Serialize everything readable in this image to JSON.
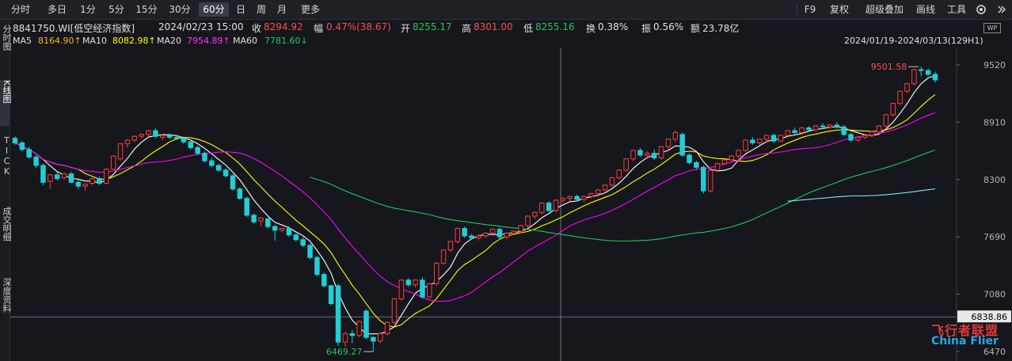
{
  "toolbar": {
    "periods": [
      "分时",
      "多日",
      "1分",
      "5分",
      "15分",
      "30分",
      "60分",
      "日",
      "周",
      "月",
      "更多"
    ],
    "active_period": "60分",
    "right": [
      "F9",
      "复权",
      "超级叠加",
      "画线",
      "工具"
    ]
  },
  "left_tabs": [
    {
      "label": "分时图",
      "active": false
    },
    {
      "label": "K线图",
      "active": true
    },
    {
      "label": "TICK",
      "active": false
    },
    {
      "label": "成交明细",
      "active": false
    },
    {
      "label": "深度资料",
      "active": false
    }
  ],
  "info_bar": {
    "code_name": "8841750.WI[低空经济指数]",
    "datetime": "2024/02/23 15:00",
    "close_label": "收",
    "close": "8294.92",
    "change_label": "幅",
    "change": "0.47%(38.67)",
    "open_label": "开",
    "open": "8255.17",
    "high_label": "高",
    "high": "8301.00",
    "low_label": "低",
    "low": "8255.16",
    "turnover_label": "换",
    "turnover": "0.38%",
    "amplitude_label": "振",
    "amplitude": "0.56%",
    "amount_label": "额",
    "amount": "23.78亿"
  },
  "ma_bar": {
    "ma5_label": "MA5",
    "ma5": "8164.90↑",
    "ma10_label": "MA10",
    "ma10": "8082.98↑",
    "ma20_label": "MA20",
    "ma20": "7954.89↑",
    "ma60_label": "MA60",
    "ma60": "7781.60↓",
    "range": "2024/01/19-2024/03/13(129H1)"
  },
  "colors": {
    "up": "#ff3b3b",
    "down": "#22cdd6",
    "ma5": "#ffffff",
    "ma10": "#ffff00",
    "ma20": "#ff00ff",
    "ma60": "#22c55e",
    "ma_cyan": "#7fe3ff"
  },
  "watermark": {
    "title": "飞行者联盟",
    "sub": "China Flier"
  },
  "chart_data": {
    "type": "candlestick",
    "title": "8841750.WI[低空经济指数]",
    "period": "60分",
    "ylim": [
      6470,
      9700
    ],
    "y_ticks": [
      "9520",
      "8910",
      "8300",
      "7690",
      "7080",
      "6470"
    ],
    "crosshair_price": "6838.86",
    "max_label": "9501.58",
    "min_label": "6469.27",
    "candles": [
      {
        "o": 8740,
        "h": 8760,
        "c": 8690,
        "l": 8670
      },
      {
        "o": 8690,
        "h": 8710,
        "c": 8620,
        "l": 8600
      },
      {
        "o": 8620,
        "h": 8650,
        "c": 8540,
        "l": 8520
      },
      {
        "o": 8540,
        "h": 8560,
        "c": 8450,
        "l": 8420
      },
      {
        "o": 8450,
        "h": 8470,
        "c": 8270,
        "l": 8240
      },
      {
        "o": 8280,
        "h": 8360,
        "c": 8350,
        "l": 8200
      },
      {
        "o": 8350,
        "h": 8380,
        "c": 8310,
        "l": 8290
      },
      {
        "o": 8320,
        "h": 8370,
        "c": 8360,
        "l": 8300
      },
      {
        "o": 8360,
        "h": 8380,
        "c": 8270,
        "l": 8260
      },
      {
        "o": 8270,
        "h": 8300,
        "c": 8230,
        "l": 8200
      },
      {
        "o": 8230,
        "h": 8260,
        "c": 8250,
        "l": 8180
      },
      {
        "o": 8260,
        "h": 8320,
        "c": 8310,
        "l": 8240
      },
      {
        "o": 8310,
        "h": 8330,
        "c": 8260,
        "l": 8240
      },
      {
        "o": 8260,
        "h": 8420,
        "c": 8410,
        "l": 8250
      },
      {
        "o": 8410,
        "h": 8560,
        "c": 8550,
        "l": 8400
      },
      {
        "o": 8520,
        "h": 8690,
        "c": 8680,
        "l": 8500
      },
      {
        "o": 8680,
        "h": 8730,
        "c": 8720,
        "l": 8640
      },
      {
        "o": 8720,
        "h": 8770,
        "c": 8760,
        "l": 8700
      },
      {
        "o": 8760,
        "h": 8790,
        "c": 8780,
        "l": 8740
      },
      {
        "o": 8780,
        "h": 8830,
        "c": 8820,
        "l": 8760
      },
      {
        "o": 8820,
        "h": 8850,
        "c": 8760,
        "l": 8740
      },
      {
        "o": 8750,
        "h": 8780,
        "c": 8770,
        "l": 8720
      },
      {
        "o": 8770,
        "h": 8790,
        "c": 8750,
        "l": 8730
      },
      {
        "o": 8750,
        "h": 8770,
        "c": 8740,
        "l": 8720
      },
      {
        "o": 8740,
        "h": 8760,
        "c": 8700,
        "l": 8680
      },
      {
        "o": 8700,
        "h": 8730,
        "c": 8640,
        "l": 8620
      },
      {
        "o": 8640,
        "h": 8660,
        "c": 8580,
        "l": 8560
      },
      {
        "o": 8580,
        "h": 8600,
        "c": 8500,
        "l": 8480
      },
      {
        "o": 8500,
        "h": 8530,
        "c": 8450,
        "l": 8430
      },
      {
        "o": 8450,
        "h": 8470,
        "c": 8400,
        "l": 8380
      },
      {
        "o": 8400,
        "h": 8420,
        "c": 8340,
        "l": 8320
      },
      {
        "o": 8340,
        "h": 8360,
        "c": 8200,
        "l": 8180
      },
      {
        "o": 8200,
        "h": 8220,
        "c": 8100,
        "l": 8080
      },
      {
        "o": 8100,
        "h": 8120,
        "c": 7920,
        "l": 7900
      },
      {
        "o": 7920,
        "h": 7940,
        "c": 7850,
        "l": 7830
      },
      {
        "o": 7860,
        "h": 7900,
        "c": 7890,
        "l": 7800
      },
      {
        "o": 7880,
        "h": 7900,
        "c": 7800,
        "l": 7780
      },
      {
        "o": 7800,
        "h": 7820,
        "c": 7760,
        "l": 7650
      },
      {
        "o": 7760,
        "h": 7790,
        "c": 7780,
        "l": 7740
      },
      {
        "o": 7780,
        "h": 7800,
        "c": 7710,
        "l": 7690
      },
      {
        "o": 7710,
        "h": 7730,
        "c": 7660,
        "l": 7640
      },
      {
        "o": 7660,
        "h": 7690,
        "c": 7600,
        "l": 7580
      },
      {
        "o": 7600,
        "h": 7620,
        "c": 7470,
        "l": 7450
      },
      {
        "o": 7470,
        "h": 7490,
        "c": 7290,
        "l": 7270
      },
      {
        "o": 7290,
        "h": 7310,
        "c": 7170,
        "l": 7150
      },
      {
        "o": 7170,
        "h": 7180,
        "c": 6980,
        "l": 6960
      },
      {
        "o": 7170,
        "h": 7190,
        "c": 6570,
        "l": 6530
      },
      {
        "o": 6570,
        "h": 6680,
        "c": 6660,
        "l": 6520
      },
      {
        "o": 6660,
        "h": 6700,
        "c": 6640,
        "l": 6560
      },
      {
        "o": 6640,
        "h": 6800,
        "c": 6790,
        "l": 6620
      },
      {
        "o": 6900,
        "h": 6920,
        "c": 6620,
        "l": 6600
      },
      {
        "o": 6620,
        "h": 6630,
        "c": 6580,
        "l": 6469
      },
      {
        "o": 6580,
        "h": 6680,
        "c": 6660,
        "l": 6560
      },
      {
        "o": 6660,
        "h": 6790,
        "c": 6780,
        "l": 6640
      },
      {
        "o": 6780,
        "h": 7040,
        "c": 7030,
        "l": 6760
      },
      {
        "o": 7030,
        "h": 7240,
        "c": 7230,
        "l": 7010
      },
      {
        "o": 7230,
        "h": 7250,
        "c": 7180,
        "l": 7160
      },
      {
        "o": 7180,
        "h": 7240,
        "c": 7230,
        "l": 7150
      },
      {
        "o": 7230,
        "h": 7260,
        "c": 7050,
        "l": 7030
      },
      {
        "o": 7050,
        "h": 7200,
        "c": 7190,
        "l": 7030
      },
      {
        "o": 7190,
        "h": 7420,
        "c": 7410,
        "l": 7170
      },
      {
        "o": 7410,
        "h": 7560,
        "c": 7550,
        "l": 7390
      },
      {
        "o": 7550,
        "h": 7650,
        "c": 7640,
        "l": 7530
      },
      {
        "o": 7640,
        "h": 7790,
        "c": 7780,
        "l": 7620
      },
      {
        "o": 7780,
        "h": 7800,
        "c": 7700,
        "l": 7680
      },
      {
        "o": 7700,
        "h": 7720,
        "c": 7680,
        "l": 7660
      },
      {
        "o": 7680,
        "h": 7720,
        "c": 7700,
        "l": 7650
      },
      {
        "o": 7700,
        "h": 7740,
        "c": 7730,
        "l": 7680
      },
      {
        "o": 7730,
        "h": 7780,
        "c": 7770,
        "l": 7700
      },
      {
        "o": 7770,
        "h": 7790,
        "c": 7690,
        "l": 7670
      },
      {
        "o": 7690,
        "h": 7740,
        "c": 7730,
        "l": 7660
      },
      {
        "o": 7730,
        "h": 7760,
        "c": 7750,
        "l": 7710
      },
      {
        "o": 7750,
        "h": 7820,
        "c": 7810,
        "l": 7730
      },
      {
        "o": 7810,
        "h": 7920,
        "c": 7910,
        "l": 7790
      },
      {
        "o": 7910,
        "h": 7960,
        "c": 7950,
        "l": 7880
      },
      {
        "o": 7950,
        "h": 8060,
        "c": 8050,
        "l": 7930
      },
      {
        "o": 8050,
        "h": 8070,
        "c": 7970,
        "l": 7950
      },
      {
        "o": 7970,
        "h": 8090,
        "c": 8080,
        "l": 7950
      },
      {
        "o": 8080,
        "h": 8110,
        "c": 8100,
        "l": 8050
      },
      {
        "o": 8100,
        "h": 8130,
        "c": 8120,
        "l": 8070
      },
      {
        "o": 8120,
        "h": 8140,
        "c": 8090,
        "l": 8070
      },
      {
        "o": 8090,
        "h": 8130,
        "c": 8120,
        "l": 8060
      },
      {
        "o": 8120,
        "h": 8160,
        "c": 8150,
        "l": 8100
      },
      {
        "o": 8150,
        "h": 8200,
        "c": 8190,
        "l": 8120
      },
      {
        "o": 8190,
        "h": 8250,
        "c": 8240,
        "l": 8170
      },
      {
        "o": 8240,
        "h": 8330,
        "c": 8320,
        "l": 8220
      },
      {
        "o": 8320,
        "h": 8410,
        "c": 8400,
        "l": 8300
      },
      {
        "o": 8400,
        "h": 8530,
        "c": 8520,
        "l": 8380
      },
      {
        "o": 8520,
        "h": 8620,
        "c": 8610,
        "l": 8500
      },
      {
        "o": 8610,
        "h": 8640,
        "c": 8560,
        "l": 8540
      },
      {
        "o": 8560,
        "h": 8600,
        "c": 8580,
        "l": 8520
      },
      {
        "o": 8580,
        "h": 8620,
        "c": 8530,
        "l": 8510
      },
      {
        "o": 8530,
        "h": 8660,
        "c": 8650,
        "l": 8510
      },
      {
        "o": 8650,
        "h": 8740,
        "c": 8730,
        "l": 8620
      },
      {
        "o": 8730,
        "h": 8820,
        "c": 8800,
        "l": 8700
      },
      {
        "o": 8780,
        "h": 8800,
        "c": 8560,
        "l": 8540
      },
      {
        "o": 8560,
        "h": 8580,
        "c": 8480,
        "l": 8460
      },
      {
        "o": 8480,
        "h": 8500,
        "c": 8430,
        "l": 8410
      },
      {
        "o": 8430,
        "h": 8450,
        "c": 8180,
        "l": 8150
      },
      {
        "o": 8180,
        "h": 8420,
        "c": 8400,
        "l": 8160
      },
      {
        "o": 8400,
        "h": 8480,
        "c": 8470,
        "l": 8380
      },
      {
        "o": 8470,
        "h": 8520,
        "c": 8510,
        "l": 8450
      },
      {
        "o": 8510,
        "h": 8560,
        "c": 8550,
        "l": 8490
      },
      {
        "o": 8550,
        "h": 8620,
        "c": 8610,
        "l": 8530
      },
      {
        "o": 8610,
        "h": 8730,
        "c": 8720,
        "l": 8590
      },
      {
        "o": 8720,
        "h": 8750,
        "c": 8690,
        "l": 8670
      },
      {
        "o": 8690,
        "h": 8740,
        "c": 8730,
        "l": 8670
      },
      {
        "o": 8730,
        "h": 8780,
        "c": 8770,
        "l": 8700
      },
      {
        "o": 8770,
        "h": 8790,
        "c": 8710,
        "l": 8690
      },
      {
        "o": 8710,
        "h": 8780,
        "c": 8770,
        "l": 8700
      },
      {
        "o": 8770,
        "h": 8830,
        "c": 8820,
        "l": 8750
      },
      {
        "o": 8820,
        "h": 8850,
        "c": 8800,
        "l": 8780
      },
      {
        "o": 8800,
        "h": 8860,
        "c": 8850,
        "l": 8780
      },
      {
        "o": 8850,
        "h": 8870,
        "c": 8830,
        "l": 8810
      },
      {
        "o": 8830,
        "h": 8880,
        "c": 8870,
        "l": 8810
      },
      {
        "o": 8870,
        "h": 8900,
        "c": 8860,
        "l": 8840
      },
      {
        "o": 8860,
        "h": 8890,
        "c": 8880,
        "l": 8840
      },
      {
        "o": 8880,
        "h": 8910,
        "c": 8860,
        "l": 8840
      },
      {
        "o": 8860,
        "h": 8880,
        "c": 8780,
        "l": 8760
      },
      {
        "o": 8780,
        "h": 8800,
        "c": 8720,
        "l": 8700
      },
      {
        "o": 8720,
        "h": 8760,
        "c": 8750,
        "l": 8700
      },
      {
        "o": 8750,
        "h": 8780,
        "c": 8770,
        "l": 8730
      },
      {
        "o": 8770,
        "h": 8820,
        "c": 8810,
        "l": 8750
      },
      {
        "o": 8810,
        "h": 8880,
        "c": 8870,
        "l": 8790
      },
      {
        "o": 8870,
        "h": 9000,
        "c": 8990,
        "l": 8850
      },
      {
        "o": 8990,
        "h": 9120,
        "c": 9110,
        "l": 8970
      },
      {
        "o": 9110,
        "h": 9250,
        "c": 9240,
        "l": 9090
      },
      {
        "o": 9240,
        "h": 9330,
        "c": 9320,
        "l": 9220
      },
      {
        "o": 9320,
        "h": 9480,
        "c": 9470,
        "l": 9300
      },
      {
        "o": 9470,
        "h": 9501.58,
        "c": 9460,
        "l": 9400
      },
      {
        "o": 9460,
        "h": 9480,
        "c": 9420,
        "l": 9400
      },
      {
        "o": 9420,
        "h": 9450,
        "c": 9360,
        "l": 9330
      }
    ]
  }
}
